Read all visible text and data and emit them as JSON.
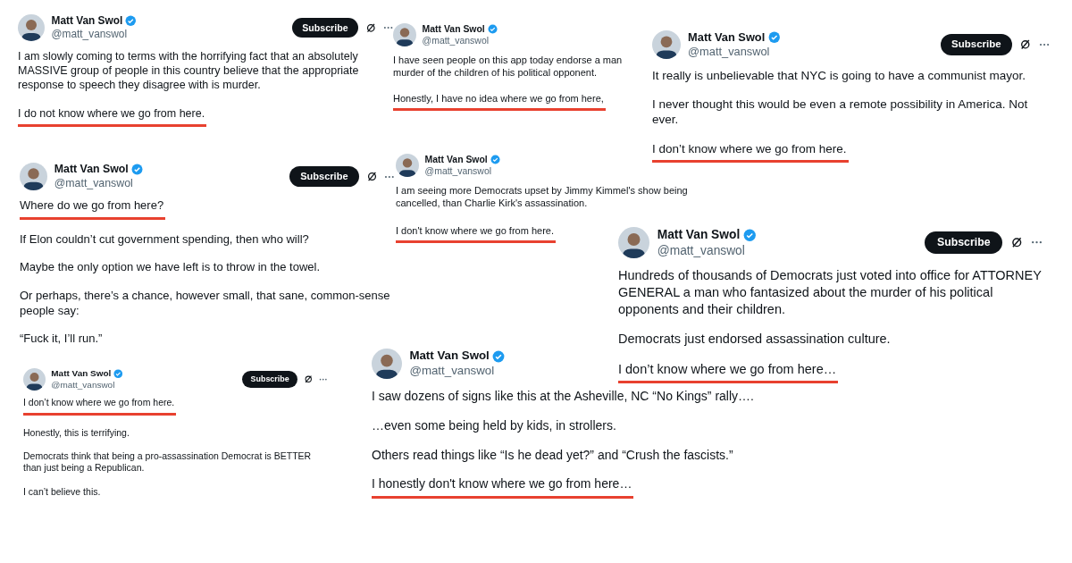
{
  "posts": [
    {
      "name": "Matt Van Swol",
      "handle": "@matt_vanswol",
      "verified": true,
      "subscribe": "Subscribe",
      "paragraphs": [
        {
          "text": "I am slowly coming to terms with the horrifying fact that an absolutely MASSIVE group of people in this country believe that the appropriate response to speech they disagree with is murder.",
          "underlined": false
        },
        {
          "text": "I do not know where we go from here.",
          "underlined": true
        }
      ]
    },
    {
      "name": "Matt Van Swol",
      "handle": "@matt_vanswol",
      "verified": true,
      "paragraphs": [
        {
          "text": "I have seen people on this app today endorse a man murder of the children of his political opponent.",
          "underlined": false
        },
        {
          "text": "Honestly, I have no idea where we go from here,",
          "underlined": true
        }
      ]
    },
    {
      "name": "Matt Van Swol",
      "handle": "@matt_vanswol",
      "verified": true,
      "subscribe": "Subscribe",
      "paragraphs": [
        {
          "text": "It really is unbelievable that NYC is going to have a communist mayor.",
          "underlined": false
        },
        {
          "text": "I never thought this would be even a remote possibility in America. Not ever.",
          "underlined": false
        },
        {
          "text": "I don’t know where we go from here.",
          "underlined": true
        }
      ]
    },
    {
      "name": "Matt Van Swol",
      "handle": "@matt_vanswol",
      "verified": true,
      "subscribe": "Subscribe",
      "paragraphs": [
        {
          "text": "Where do we go from here?",
          "underlined": true
        },
        {
          "text": "If Elon couldn’t cut government spending, then who will?",
          "underlined": false
        },
        {
          "text": "Maybe the only option we have left is to throw in the towel.",
          "underlined": false
        },
        {
          "text": "Or perhaps, there’s a chance, however small, that sane, common-sense people say:",
          "underlined": false
        },
        {
          "text": "“Fuck it, I’ll run.”",
          "underlined": false
        }
      ]
    },
    {
      "name": "Matt Van Swol",
      "handle": "@matt_vanswol",
      "verified": true,
      "paragraphs": [
        {
          "text": "I am seeing more Democrats upset by Jimmy Kimmel's show being cancelled, than Charlie Kirk's assassination.",
          "underlined": false
        },
        {
          "text": "I don't know where we go from here.",
          "underlined": true
        }
      ]
    },
    {
      "name": "Matt Van Swol",
      "handle": "@matt_vanswol",
      "verified": true,
      "subscribe": "Subscribe",
      "paragraphs": [
        {
          "text": "Hundreds of thousands of Democrats just voted into office for ATTORNEY GENERAL a man who fantasized about the murder of his political opponents and their children.",
          "underlined": false
        },
        {
          "text": "Democrats just endorsed assassination culture.",
          "underlined": false
        },
        {
          "text": "I don’t know where we go from here…",
          "underlined": true
        }
      ]
    },
    {
      "name": "Matt Van Swol",
      "handle": "@matt_vanswol",
      "verified": true,
      "subscribe": "Subscribe",
      "paragraphs": [
        {
          "text": "I don’t know where we go from here.",
          "underlined": true
        },
        {
          "text": "Honestly, this is terrifying.",
          "underlined": false
        },
        {
          "text": "Democrats think that being a pro-assassination Democrat is BETTER than just being a Republican.",
          "underlined": false
        },
        {
          "text": "I can’t believe this.",
          "underlined": false
        }
      ]
    },
    {
      "name": "Matt Van Swol",
      "handle": "@matt_vanswol",
      "verified": true,
      "paragraphs": [
        {
          "text": "I saw dozens of signs like this at the Asheville, NC “No Kings” rally….",
          "underlined": false
        },
        {
          "text": "…even some being held by kids, in strollers.",
          "underlined": false
        },
        {
          "text": "Others read things like “Is he dead yet?” and “Crush the fascists.”",
          "underlined": false
        },
        {
          "text": "I honestly don't know where we go from here…",
          "underlined": true
        }
      ]
    }
  ]
}
